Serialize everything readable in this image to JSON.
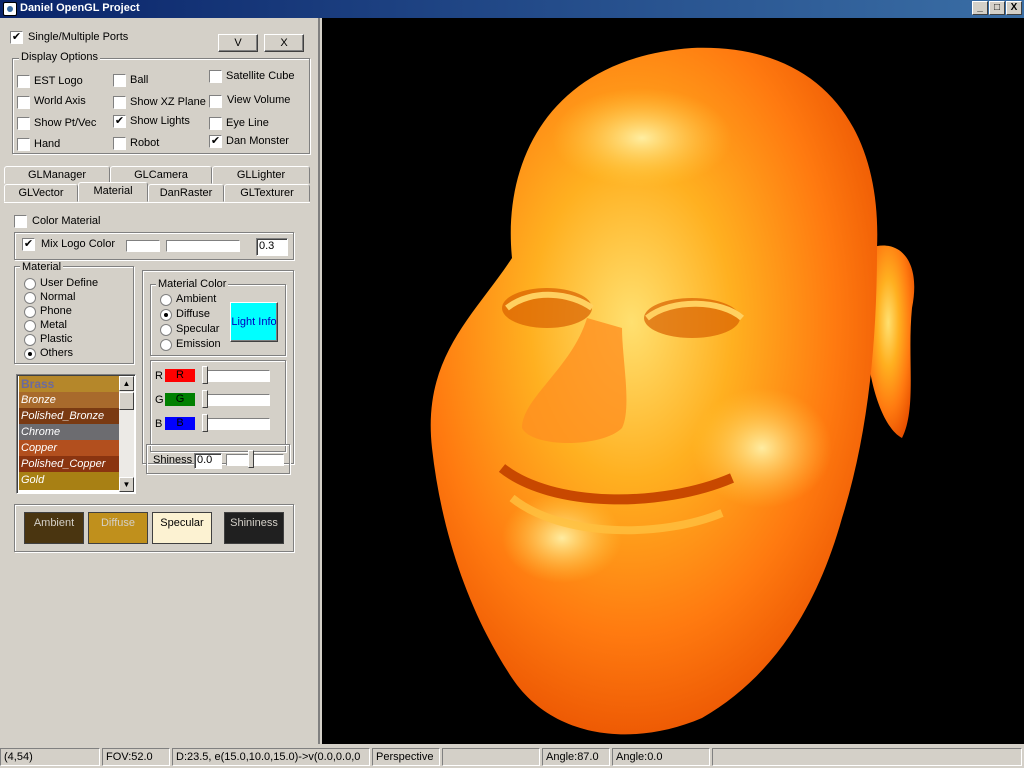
{
  "window": {
    "title": "Daniel OpenGL Project",
    "min": "_",
    "max": "□",
    "close": "X"
  },
  "top": {
    "ports_label": "Single/Multiple Ports",
    "ports_checked": "✔",
    "v_button": "V",
    "x_button": "X"
  },
  "display_options": {
    "title": "Display Options",
    "items": [
      {
        "label": "EST Logo",
        "mark": ""
      },
      {
        "label": "Ball",
        "mark": ""
      },
      {
        "label": "Satellite Cube",
        "mark": ""
      },
      {
        "label": "World Axis",
        "mark": ""
      },
      {
        "label": "Show XZ Plane",
        "mark": ""
      },
      {
        "label": "View Volume",
        "mark": ""
      },
      {
        "label": "Show Pt/Vec",
        "mark": ""
      },
      {
        "label": "Show Lights",
        "mark": "✔"
      },
      {
        "label": "Eye Line",
        "mark": ""
      },
      {
        "label": "Hand",
        "mark": ""
      },
      {
        "label": "Robot",
        "mark": ""
      },
      {
        "label": "Dan Monster",
        "mark": "✔"
      }
    ]
  },
  "tabs": {
    "row1": [
      "GLManager",
      "GLCamera",
      "GLLighter"
    ],
    "row2": [
      "GLVector",
      "Material",
      "DanRaster",
      "GLTexturer"
    ]
  },
  "material_tab": {
    "color_material": "Color Material",
    "mix_logo": "Mix Logo Color",
    "mix_logo_mark": "✔",
    "mix_value": "0.3",
    "material_group": "Material",
    "material_options": [
      "User Define",
      "Normal",
      "Phone",
      "Metal",
      "Plastic",
      "Others"
    ],
    "material_color_group": "Material Color",
    "color_options": [
      "Ambient",
      "Diffuse",
      "Specular",
      "Emission"
    ],
    "light_info": "Light Info",
    "r_label": "R",
    "g_label": "G",
    "b_label": "B",
    "r_box": "R",
    "g_box": "G",
    "b_box": "B",
    "shiness_label": "Shiness",
    "shiness_value": "0.0",
    "list": [
      {
        "name": "Brass",
        "color": "#b5872a"
      },
      {
        "name": "Bronze",
        "color": "#a86a2c"
      },
      {
        "name": "Polished_Bronze",
        "color": "#7a3a12"
      },
      {
        "name": "Chrome",
        "color": "#6c6c70"
      },
      {
        "name": "Copper",
        "color": "#b24f1e"
      },
      {
        "name": "Polished_Copper",
        "color": "#8a3410"
      },
      {
        "name": "Gold",
        "color": "#a88014"
      }
    ],
    "swatches": [
      {
        "label": "Ambient",
        "bg": "#4a3510",
        "fg": "#d4d0c8"
      },
      {
        "label": "Diffuse",
        "bg": "#c0901c",
        "fg": "#d4d0c8"
      },
      {
        "label": "Specular",
        "bg": "#fcf2d2",
        "fg": "#000000"
      },
      {
        "label": "Shininess",
        "bg": "#202020",
        "fg": "#d4d0c8"
      }
    ]
  },
  "status": {
    "coords": "(4,54)",
    "fov": "FOV:52.0",
    "distance": "D:23.5, e(15.0,10.0,15.0)->v(0.0,0.0,0",
    "projection": "Perspective",
    "angle1": "Angle:87.0",
    "angle2": "Angle:0.0"
  }
}
